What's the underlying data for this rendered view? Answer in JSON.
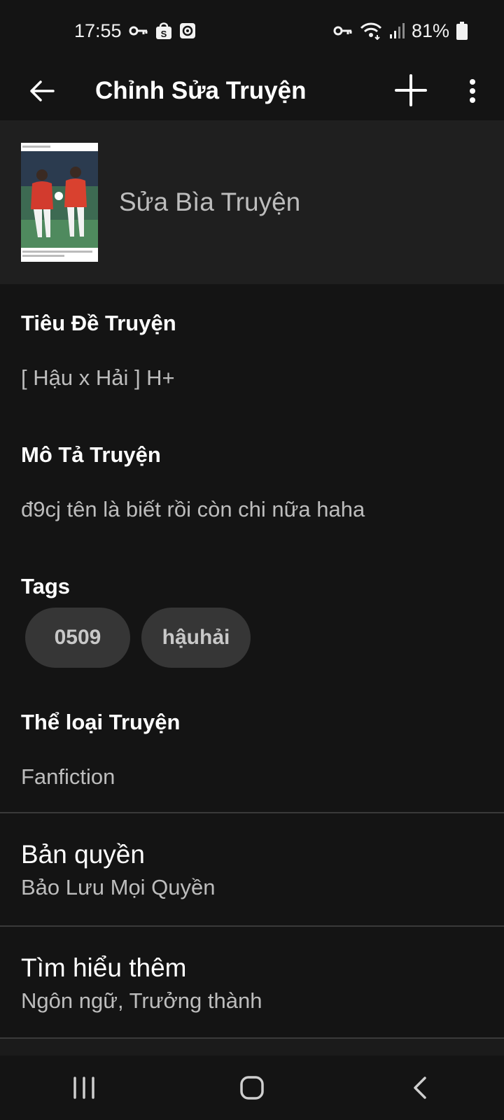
{
  "status_bar": {
    "time": "17:55",
    "battery": "81%",
    "icons_left": [
      "key-icon",
      "shopee-icon",
      "screen-record-icon"
    ],
    "icons_right": [
      "vpn-key-icon",
      "wifi-icon",
      "signal-icon",
      "battery-icon"
    ]
  },
  "toolbar": {
    "title": "Chỉnh Sửa Truyện",
    "back_icon": "arrow-left-icon",
    "add_icon": "plus-icon",
    "more_icon": "more-vertical-icon"
  },
  "cover": {
    "label": "Sửa Bìa Truyện"
  },
  "fields": {
    "title_label": "Tiêu Đề Truyện",
    "title_value": "[ Hậu x Hải ] H+",
    "description_label": "Mô Tả Truyện",
    "description_value": "đ9cj tên là biết rồi còn chi nữa haha",
    "tags_label": "Tags",
    "tags": [
      "0509",
      "hậuhải"
    ],
    "genre_label": "Thể loại Truyện",
    "genre_value": "Fanfiction"
  },
  "rows": {
    "copyright_title": "Bản quyền",
    "copyright_value": "Bảo Lưu Mọi Quyền",
    "more_title": "Tìm hiểu thêm",
    "more_value": "Ngôn ngữ, Trưởng thành"
  },
  "nav_bar": {
    "recents_icon": "recents-icon",
    "home_icon": "home-icon",
    "back_icon": "back-chevron-icon"
  },
  "colors": {
    "background": "#141414",
    "cover_background": "#1f1f1f",
    "tag_background": "#363636",
    "secondary_text": "#bdbdbd"
  }
}
